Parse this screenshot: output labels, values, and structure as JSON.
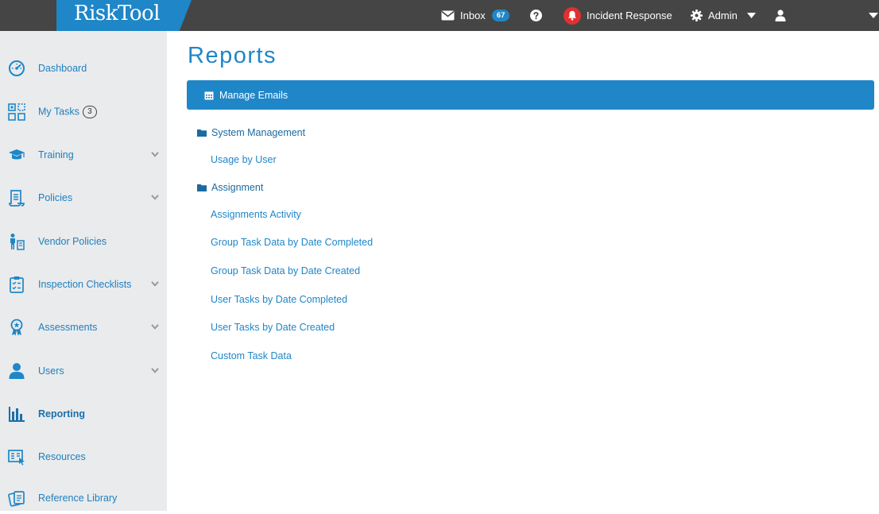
{
  "brand": {
    "logo_text": "RiskTool",
    "accent": "#1f86c8",
    "topbar_bg": "#454545",
    "alert_red": "#e0302f"
  },
  "topbar": {
    "inbox_label": "Inbox",
    "inbox_count": "67",
    "incident_label": "Incident Response",
    "admin_label": "Admin"
  },
  "sidebar": {
    "items": [
      {
        "label": "Dashboard",
        "icon": "dashboard-gauge-icon"
      },
      {
        "label": "My Tasks",
        "count": "3",
        "icon": "tasks-grid-icon"
      },
      {
        "label": "Training",
        "icon": "graduation-cap-icon",
        "expandable": true
      },
      {
        "label": "Policies",
        "icon": "scroll-document-icon",
        "expandable": true
      },
      {
        "label": "Vendor Policies",
        "icon": "vendor-person-icon"
      },
      {
        "label": "Inspection Checklists",
        "icon": "clipboard-check-icon",
        "expandable": true
      },
      {
        "label": "Assessments",
        "icon": "award-ribbon-icon",
        "expandable": true
      },
      {
        "label": "Users",
        "icon": "user-icon",
        "expandable": true
      },
      {
        "label": "Reporting",
        "icon": "bar-chart-icon",
        "active": true
      },
      {
        "label": "Resources",
        "icon": "resources-doc-icon"
      },
      {
        "label": "Reference Library",
        "icon": "library-copy-icon"
      }
    ]
  },
  "main": {
    "title": "Reports",
    "manage_emails_label": "Manage Emails",
    "groups": [
      {
        "name": "System Management",
        "reports": [
          "Usage by User"
        ]
      },
      {
        "name": "Assignment",
        "reports": [
          "Assignments Activity",
          "Group Task Data by Date Completed",
          "Group Task Data by Date Created",
          "User Tasks by Date Completed",
          "User Tasks by Date Created",
          "Custom Task Data"
        ]
      }
    ]
  }
}
